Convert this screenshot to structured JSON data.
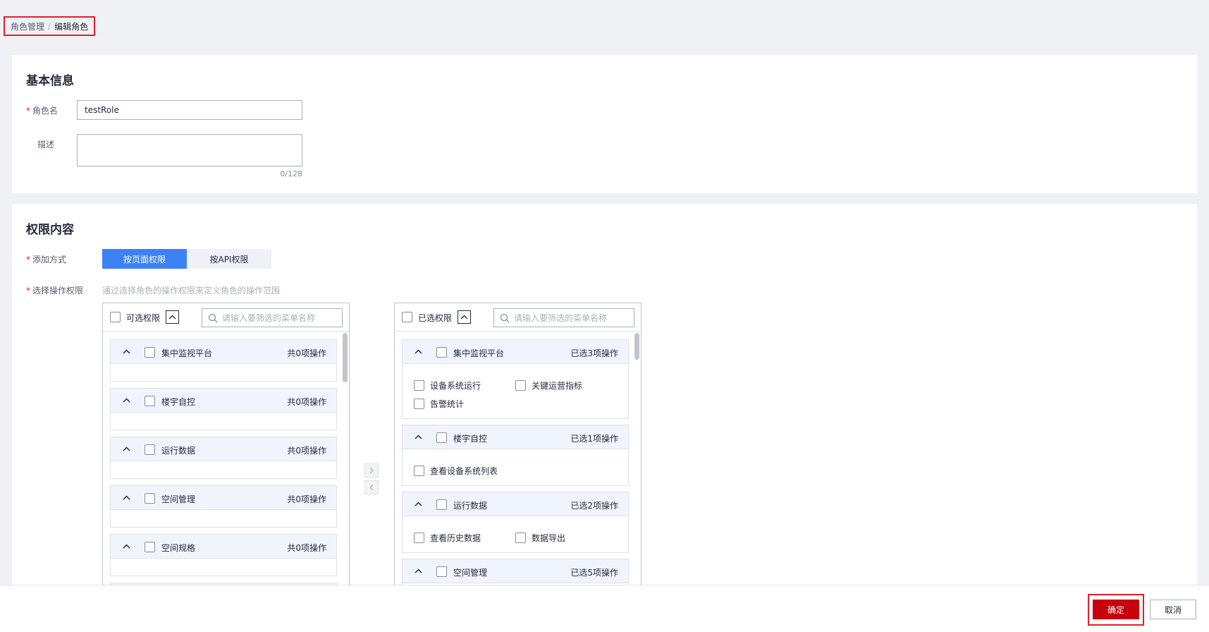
{
  "breadcrumb": {
    "parent": "角色管理",
    "separator": "/",
    "current": "编辑角色"
  },
  "basic_info": {
    "title": "基本信息",
    "role_name_label": "角色名",
    "role_name_value": "testRole",
    "description_label": "描述",
    "description_value": "",
    "char_count": "0/128"
  },
  "permissions": {
    "title": "权限内容",
    "add_method_label": "添加方式",
    "add_method_options": [
      "按页面权限",
      "按API权限"
    ],
    "add_method_selected": "按页面权限",
    "select_ops_label": "选择操作权限",
    "select_ops_hint": "通过选择角色的操作权限来定义角色的操作范围",
    "available": {
      "label": "可选权限",
      "search_placeholder": "请输入要筛选的菜单名称",
      "groups": [
        {
          "name": "集中监视平台",
          "count": "共0项操作"
        },
        {
          "name": "楼宇自控",
          "count": "共0项操作"
        },
        {
          "name": "运行数据",
          "count": "共0项操作"
        },
        {
          "name": "空间管理",
          "count": "共0项操作"
        },
        {
          "name": "空间规格",
          "count": "共0项操作"
        }
      ]
    },
    "selected": {
      "label": "已选权限",
      "search_placeholder": "请输入要筛选的菜单名称",
      "groups": [
        {
          "name": "集中监视平台",
          "count": "已选3项操作",
          "items": [
            "设备系统运行",
            "关键运营指标",
            "告警统计"
          ]
        },
        {
          "name": "楼宇自控",
          "count": "已选1项操作",
          "items": [
            "查看设备系统列表"
          ]
        },
        {
          "name": "运行数据",
          "count": "已选2项操作",
          "items": [
            "查看历史数据",
            "数据导出"
          ]
        },
        {
          "name": "空间管理",
          "count": "已选5项操作",
          "items": []
        }
      ]
    }
  },
  "footer": {
    "confirm_label": "确定",
    "cancel_label": "取消"
  },
  "colors": {
    "primary": "#3b82f6",
    "danger": "#c7000b",
    "highlight": "#e0202b",
    "required": "#e0202b"
  }
}
